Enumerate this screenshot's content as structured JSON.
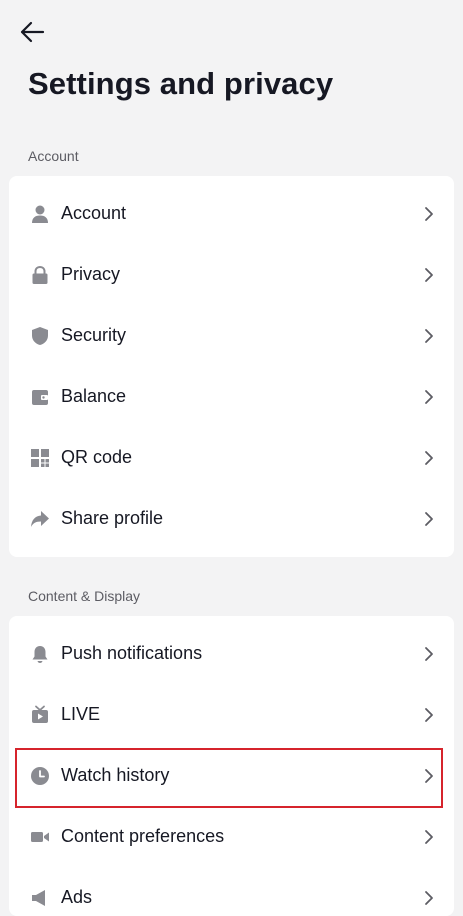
{
  "header": {
    "back_icon": "arrow-left-icon",
    "title": "Settings and privacy"
  },
  "sections": [
    {
      "title": "Account",
      "items": [
        {
          "label": "Account",
          "icon": "person-icon"
        },
        {
          "label": "Privacy",
          "icon": "lock-icon"
        },
        {
          "label": "Security",
          "icon": "shield-icon"
        },
        {
          "label": "Balance",
          "icon": "wallet-icon"
        },
        {
          "label": "QR code",
          "icon": "qr-code-icon"
        },
        {
          "label": "Share profile",
          "icon": "share-arrow-icon"
        }
      ]
    },
    {
      "title": "Content & Display",
      "items": [
        {
          "label": "Push notifications",
          "icon": "bell-icon"
        },
        {
          "label": "LIVE",
          "icon": "live-tv-icon"
        },
        {
          "label": "Watch history",
          "icon": "clock-icon",
          "highlighted": true
        },
        {
          "label": "Content preferences",
          "icon": "video-camera-icon"
        },
        {
          "label": "Ads",
          "icon": "megaphone-icon"
        }
      ]
    }
  ],
  "colors": {
    "background": "#f3f3f4",
    "card": "#ffffff",
    "icon_gray": "#8a8b91",
    "highlight_red": "#d6242c"
  }
}
